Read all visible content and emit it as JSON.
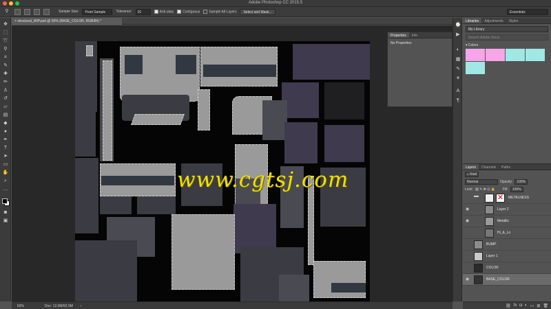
{
  "window": {
    "title": "Adobe Photoshop CC 2015.5"
  },
  "options_bar": {
    "sample_size_label": "Sample Size:",
    "sample_size_value": "Point Sample",
    "tolerance_label": "Tolerance:",
    "tolerance_value": "20",
    "anti_alias_label": "Anti-alias",
    "contiguous_label": "Contiguous",
    "sample_all_layers_label": "Sample All Layers",
    "select_mask_label": "Select and Mask...",
    "workspace": "Essentials"
  },
  "document": {
    "tab_title": "structural_WIP.psd @ 50% (BASE_COLOR, RGB/8#) *"
  },
  "watermark": "www.cgtsj.com",
  "status": {
    "zoom": "50%",
    "doc_info": "Doc: 12.0M/92.0M"
  },
  "properties_panel": {
    "tabs": [
      "Properties",
      "Info"
    ],
    "message": "No Properties"
  },
  "libraries_panel": {
    "tabs": [
      "Libraries",
      "Adjustments",
      "Styles"
    ],
    "library": "My Library",
    "search_placeholder": "Search Adobe Stock",
    "group": "Colors",
    "swatch_colors": [
      "#f6a6e8",
      "#f6a6e8",
      "#9fe8e6",
      "#9fe8e6",
      "#9fe8e6"
    ]
  },
  "layers_panel": {
    "tabs": [
      "Layers",
      "Channels",
      "Paths"
    ],
    "kind_label": "Kind",
    "blend_mode": "Normal",
    "opacity_label": "Opacity:",
    "opacity_value": "100%",
    "lock_label": "Lock:",
    "fill_label": "Fill:",
    "fill_value": "100%",
    "layers": [
      {
        "name": "METALNESS",
        "visible": false
      },
      {
        "name": "Layer 2",
        "visible": true
      },
      {
        "name": "Metallic",
        "visible": true
      },
      {
        "name": "Hi_&_Lo",
        "visible": false
      },
      {
        "name": "BUMP",
        "visible": false
      },
      {
        "name": "Layer 1",
        "visible": false
      },
      {
        "name": "COLOR",
        "visible": false
      },
      {
        "name": "BASE_COLOR",
        "visible": true,
        "selected": true
      }
    ]
  }
}
